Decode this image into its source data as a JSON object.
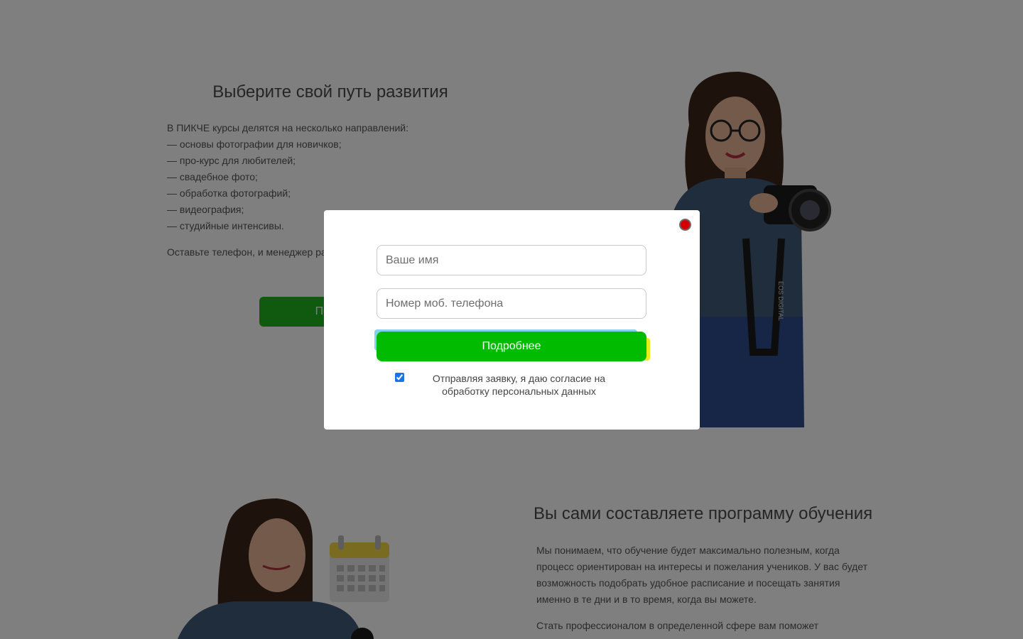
{
  "section1": {
    "title": "Выберите свой путь развития",
    "intro": "В ПИКЧЕ курсы делятся на несколько направлений:",
    "items": [
      "— основы фотографии для новичков;",
      "— про-курс для любителей;",
      "— свадебное фото;",
      "— обработка фотографий;",
      "— видеография;",
      "— студийные интенсивы."
    ],
    "outro": "Оставьте телефон, и менеджер ра... понравившемся вам курсе.",
    "button_label": "Под..."
  },
  "section2": {
    "title": "Вы сами составляете программу обучения",
    "paragraph1": "Мы понимаем, что обучение будет максимально полезным, когда процесс ориентирован на интересы и пожелания учеников. У вас будет возможность подобрать удобное расписание и посещать занятия именно в те дни и в то время, когда вы можете.",
    "paragraph2": "Стать профессионалом в определенной сфере вам поможет"
  },
  "modal": {
    "name_placeholder": "Ваше имя",
    "phone_placeholder": "Номер моб. телефона",
    "submit_label": "Подробнее",
    "consent_text": "Отправляя заявку, я даю согласие на обработку персональных данных",
    "consent_checked": true
  },
  "camera_strap_text": "EOS DIGITAL",
  "colors": {
    "accent_green": "#00bb00",
    "close_red": "#d40000"
  }
}
